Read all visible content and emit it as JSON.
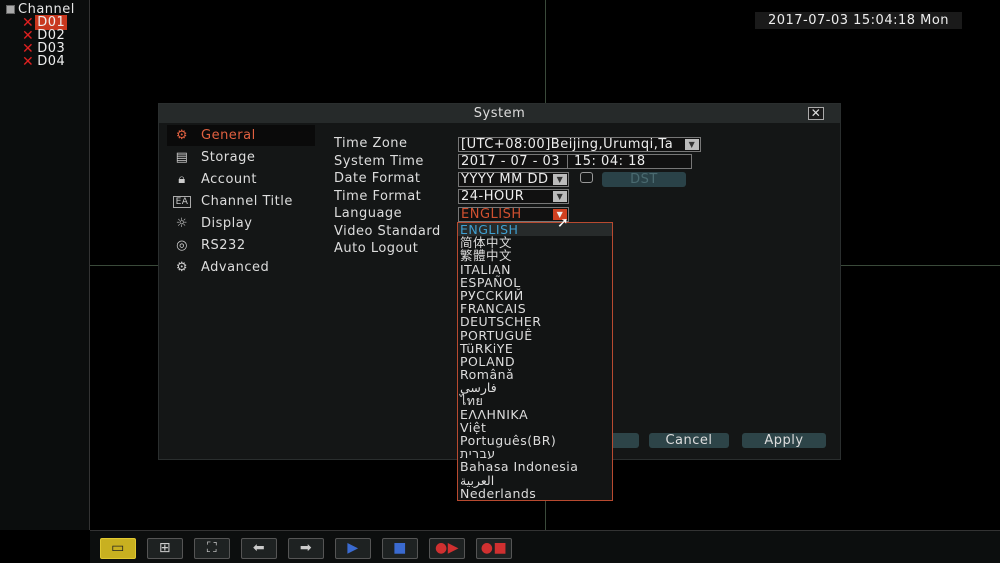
{
  "channel_panel": {
    "title": "Channel",
    "channels": [
      {
        "label": "D01",
        "selected": true
      },
      {
        "label": "D02"
      },
      {
        "label": "D03"
      },
      {
        "label": "D04"
      }
    ]
  },
  "clock": "2017-07-03 15:04:18 Mon",
  "dialog": {
    "title": "System",
    "nav": [
      {
        "label": "General",
        "icon": "gear-icon",
        "selected": true
      },
      {
        "label": "Storage",
        "icon": "hdd-icon"
      },
      {
        "label": "Account",
        "icon": "lock-icon"
      },
      {
        "label": "Channel Title",
        "icon": "channel-title-icon"
      },
      {
        "label": "Display",
        "icon": "sun-icon"
      },
      {
        "label": "RS232",
        "icon": "serial-icon"
      },
      {
        "label": "Advanced",
        "icon": "gear-icon"
      }
    ],
    "fields": {
      "time_zone": {
        "label": "Time Zone",
        "value": "[UTC+08:00]Beijing,Urumqi,Ta"
      },
      "system_time": {
        "label": "System Time",
        "date": "2017 - 07 - 03",
        "time": "15: 04: 18"
      },
      "date_format": {
        "label": "Date Format",
        "value": "YYYY MM DD",
        "dst_label": "DST",
        "dst_checked": false
      },
      "time_format": {
        "label": "Time Format",
        "value": "24-HOUR"
      },
      "language": {
        "label": "Language",
        "value": "ENGLISH"
      },
      "video_standard": {
        "label": "Video Standard"
      },
      "auto_logout": {
        "label": "Auto Logout"
      }
    },
    "language_options": [
      "ENGLISH",
      "简体中文",
      "繁體中文",
      "ITALIAN",
      "ESPAÑOL",
      "РУССКИЙ",
      "FRANCAIS",
      "DEUTSCHER",
      "PORTUGUÊ",
      "TüRKiYE",
      "POLAND",
      "Românǎ",
      "فارسی",
      "ไทย",
      "ΕΛΛΗΝΙΚΑ",
      "Việt",
      "Português(BR)",
      "עברית",
      "Bahasa Indonesia",
      "العربية",
      "Nederlands"
    ],
    "buttons": {
      "cancel": "Cancel",
      "apply": "Apply"
    },
    "accent": "#e06040"
  },
  "toolbar": [
    "single-view-icon",
    "quad-view-icon",
    "fullscreen-icon",
    "arrow-left-icon",
    "arrow-right-icon",
    "start-sequence-icon",
    "stop-sequence-icon",
    "start-record-icon",
    "stop-record-icon"
  ]
}
